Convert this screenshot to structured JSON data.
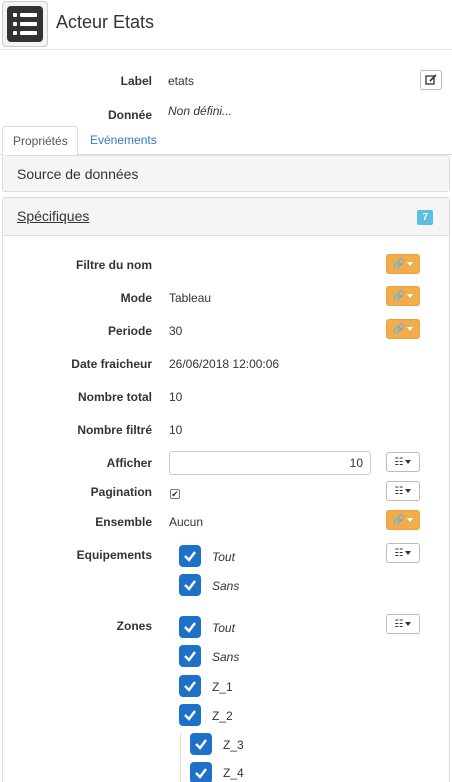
{
  "header": {
    "title": "Acteur Etats"
  },
  "top_fields": [
    {
      "label": "Label",
      "value": "etats"
    },
    {
      "label": "Donnée",
      "value": "Non défini..."
    }
  ],
  "tabs": [
    {
      "label": "Propriétés"
    },
    {
      "label": "Evénements"
    }
  ],
  "panels": {
    "source": {
      "title": "Source de données"
    },
    "specifiques": {
      "title": "Spécifiques",
      "badge": "7"
    }
  },
  "fields": [
    {
      "label": "Filtre du nom",
      "value": ""
    },
    {
      "label": "Mode",
      "value": "Tableau"
    },
    {
      "label": "Periode",
      "value": "30"
    },
    {
      "label": "Date fraicheur",
      "value": "26/06/2018 12:00:06"
    },
    {
      "label": "Nombre total",
      "value": "10"
    },
    {
      "label": "Nombre filtré",
      "value": "10"
    },
    {
      "label": "Afficher",
      "value": "10"
    },
    {
      "label": "Pagination",
      "value": "✔"
    },
    {
      "label": "Ensemble",
      "value": "Aucun"
    },
    {
      "label": "Equipements"
    },
    {
      "label": "Zones"
    }
  ],
  "equipements": [
    "Tout",
    "Sans"
  ],
  "zones": [
    "Tout",
    "Sans",
    "Z_1",
    "Z_2",
    "Z_3",
    "Z_4"
  ],
  "colors": {
    "accent": "#f0ad4e",
    "checkbox": "#1d72c7",
    "badge": "#5bc0de",
    "link": "#337ab7"
  }
}
